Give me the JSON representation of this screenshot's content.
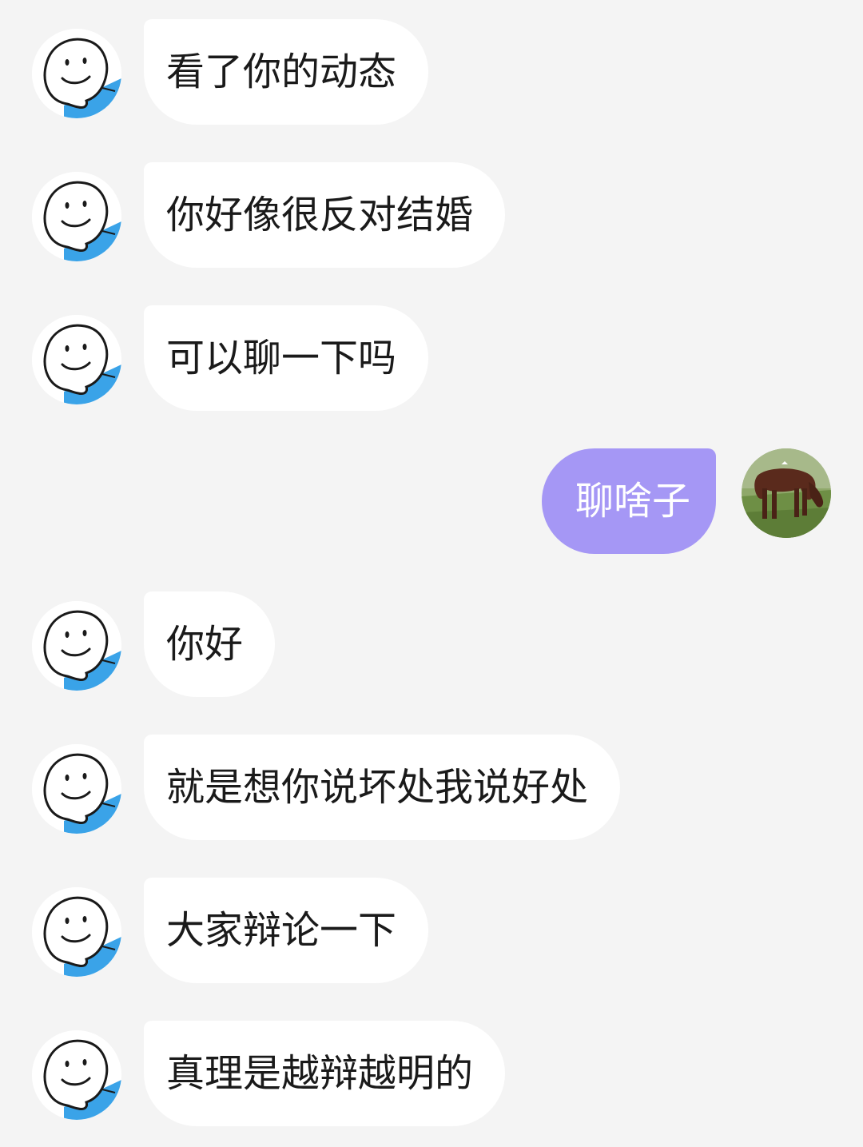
{
  "colors": {
    "background": "#f4f4f4",
    "incoming_bubble": "#ffffff",
    "outgoing_bubble": "#a597f5",
    "avatar_accent": "#3aa3e8"
  },
  "messages": [
    {
      "direction": "incoming",
      "avatar": "smiley-avatar-icon",
      "text": "看了你的动态"
    },
    {
      "direction": "incoming",
      "avatar": "smiley-avatar-icon",
      "text": "你好像很反对结婚"
    },
    {
      "direction": "incoming",
      "avatar": "smiley-avatar-icon",
      "text": "可以聊一下吗"
    },
    {
      "direction": "outgoing",
      "avatar": "cow-photo-avatar",
      "text": "聊啥子"
    },
    {
      "direction": "incoming",
      "avatar": "smiley-avatar-icon",
      "text": "你好"
    },
    {
      "direction": "incoming",
      "avatar": "smiley-avatar-icon",
      "text": "就是想你说坏处我说好处"
    },
    {
      "direction": "incoming",
      "avatar": "smiley-avatar-icon",
      "text": "大家辩论一下"
    },
    {
      "direction": "incoming",
      "avatar": "smiley-avatar-icon",
      "text": "真理是越辩越明的"
    }
  ]
}
